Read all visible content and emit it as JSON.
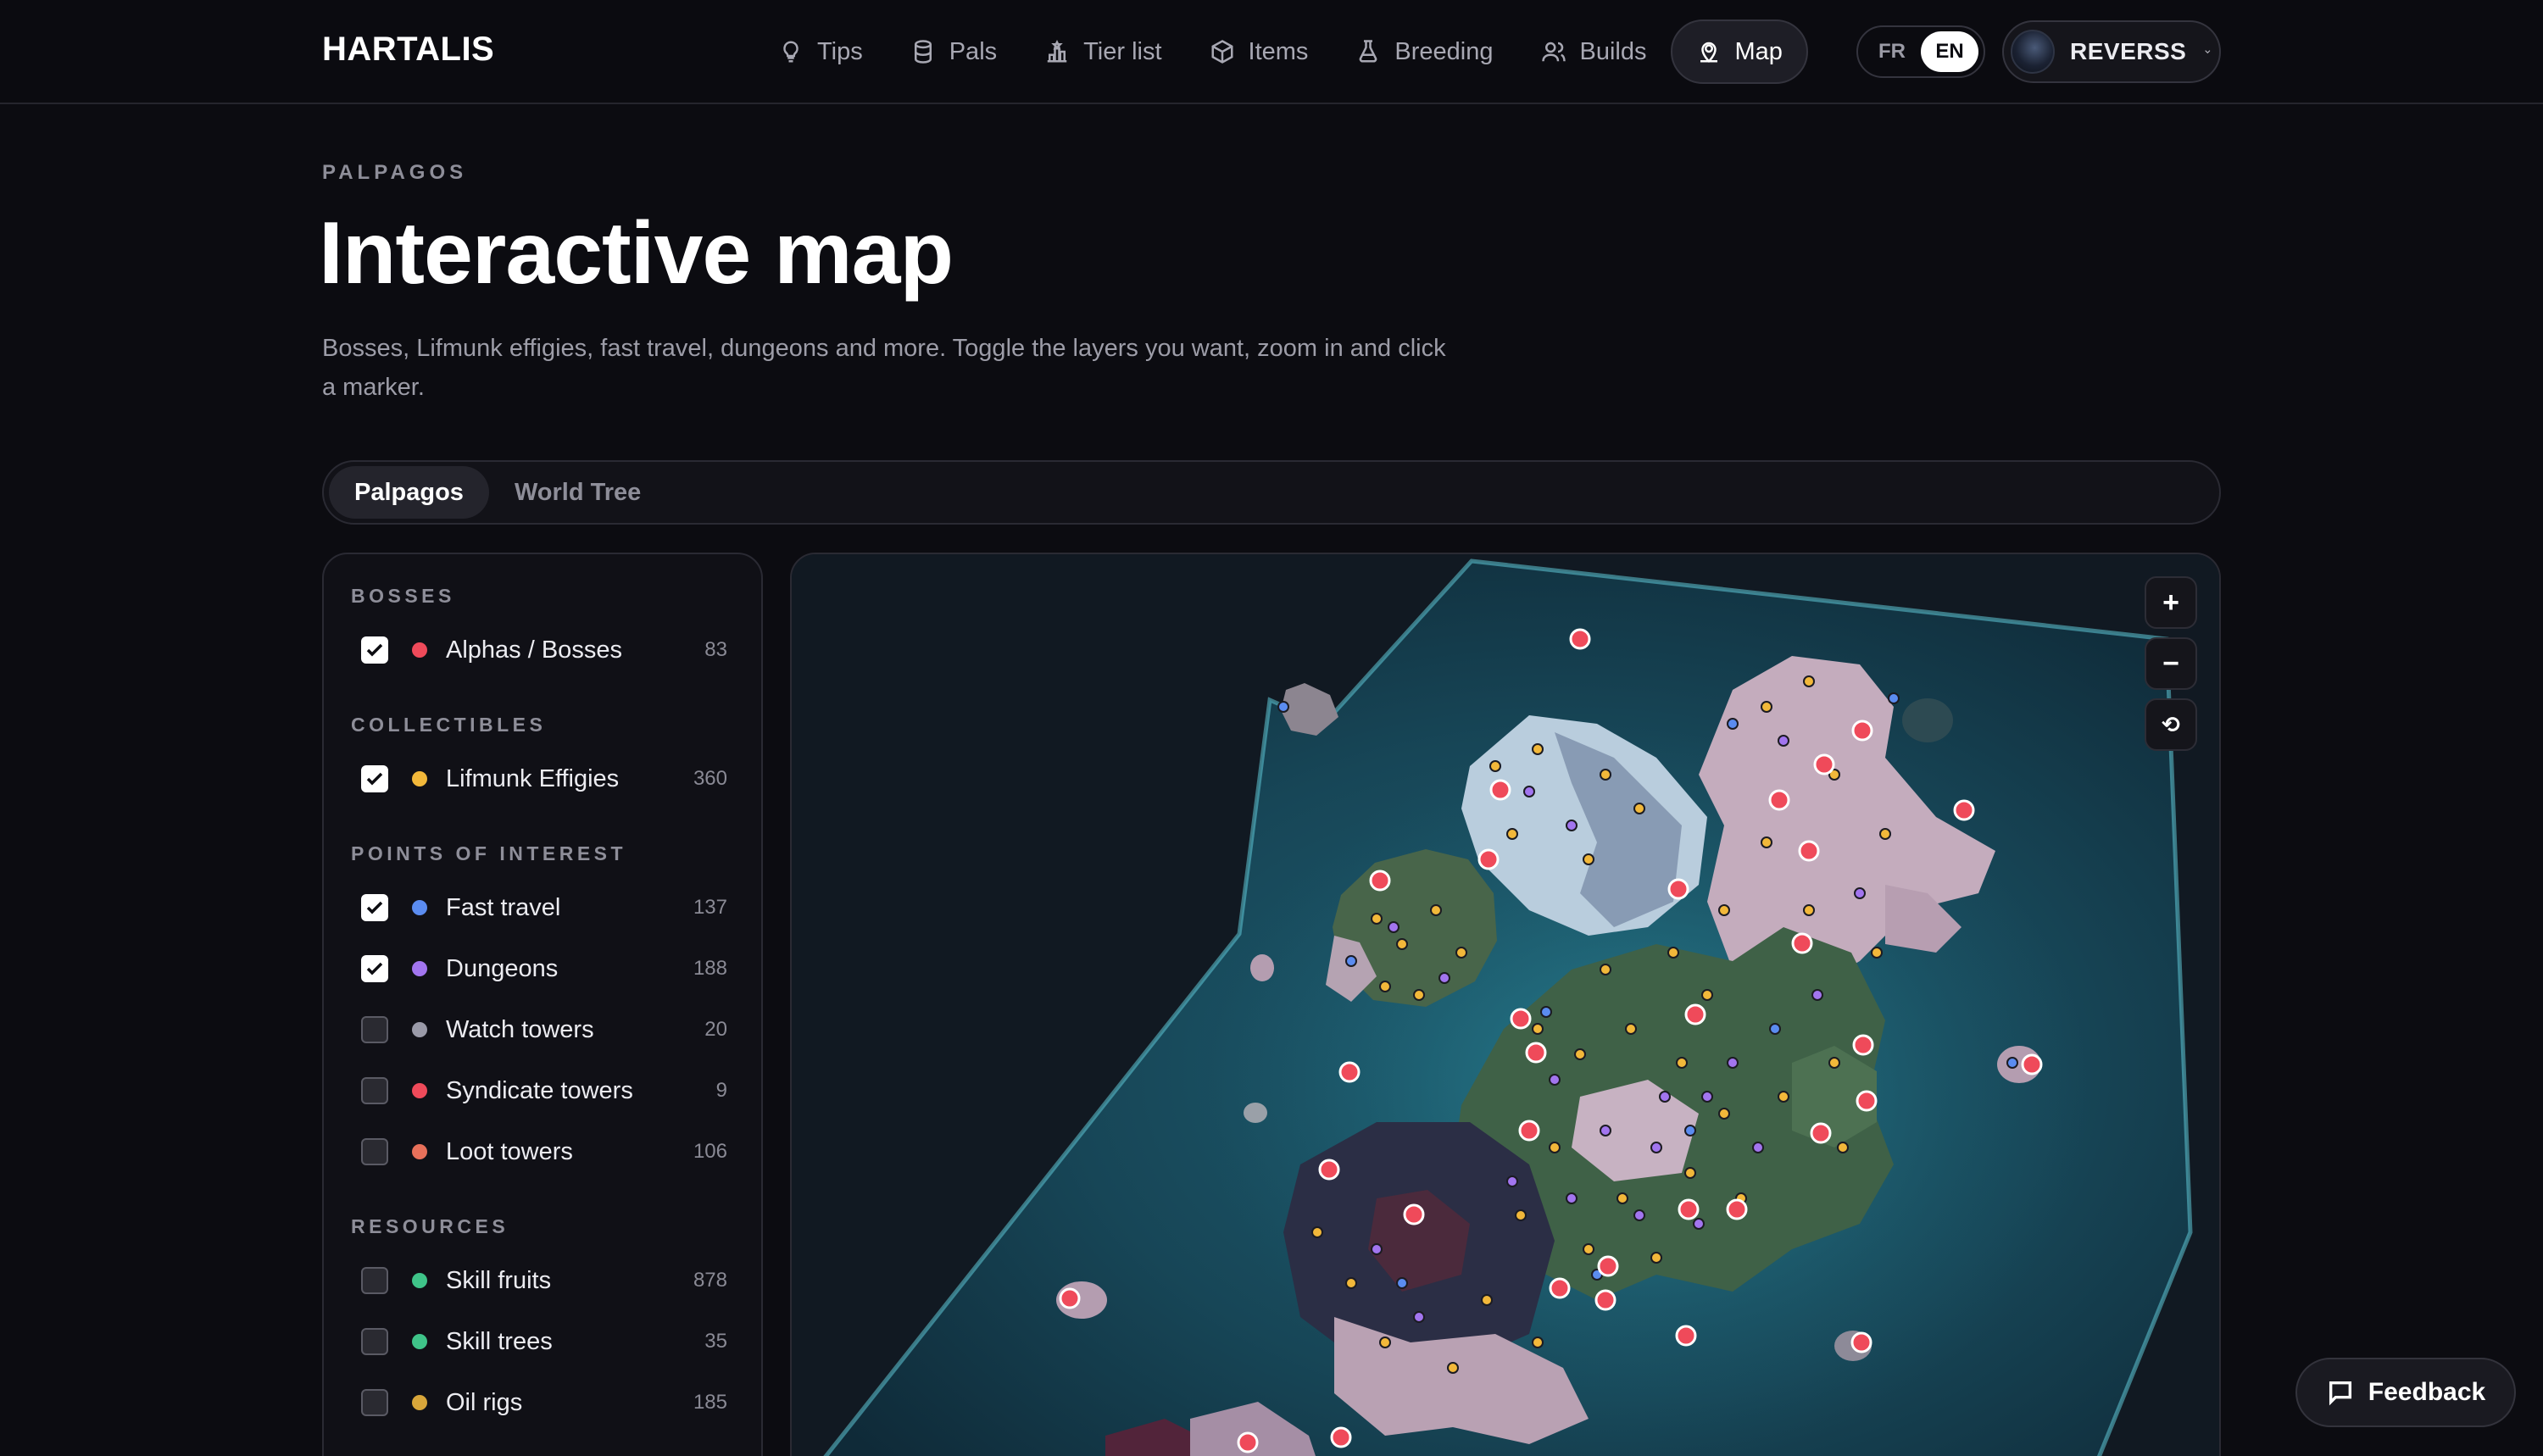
{
  "header": {
    "logo": "HARTALIS",
    "nav": [
      {
        "label": "Tips",
        "icon": "lightbulb-icon"
      },
      {
        "label": "Pals",
        "icon": "database-icon"
      },
      {
        "label": "Tier list",
        "icon": "podium-icon"
      },
      {
        "label": "Items",
        "icon": "cube-icon"
      },
      {
        "label": "Breeding",
        "icon": "flask-icon"
      },
      {
        "label": "Builds",
        "icon": "users-icon"
      },
      {
        "label": "Map",
        "icon": "map-pin-icon",
        "active": true
      }
    ],
    "lang": {
      "fr": "FR",
      "en": "EN",
      "selected": "EN"
    },
    "user": {
      "name": "REVERSS"
    }
  },
  "page": {
    "eyebrow": "PALPAGOS",
    "title": "Interactive map",
    "subtitle": "Bosses, Lifmunk effigies, fast travel, dungeons and more. Toggle the layers you want, zoom in and click a marker."
  },
  "tabs": [
    {
      "label": "Palpagos",
      "active": true
    },
    {
      "label": "World Tree",
      "active": false
    }
  ],
  "layers": {
    "groups": [
      {
        "title": "BOSSES",
        "items": [
          {
            "label": "Alphas / Bosses",
            "count": "83",
            "color": "#ef4a5a",
            "checked": true
          }
        ]
      },
      {
        "title": "COLLECTIBLES",
        "items": [
          {
            "label": "Lifmunk Effigies",
            "count": "360",
            "color": "#f2b83a",
            "checked": true
          }
        ]
      },
      {
        "title": "POINTS OF INTEREST",
        "items": [
          {
            "label": "Fast travel",
            "count": "137",
            "color": "#5b8cf0",
            "checked": true
          },
          {
            "label": "Dungeons",
            "count": "188",
            "color": "#a275ef",
            "checked": true
          },
          {
            "label": "Watch towers",
            "count": "20",
            "color": "#9a9aa8",
            "checked": false
          },
          {
            "label": "Syndicate towers",
            "count": "9",
            "color": "#ef4a5a",
            "checked": false
          },
          {
            "label": "Loot towers",
            "count": "106",
            "color": "#e8705a",
            "checked": false
          }
        ]
      },
      {
        "title": "RESOURCES",
        "items": [
          {
            "label": "Skill fruits",
            "count": "878",
            "color": "#3fc489",
            "checked": false
          },
          {
            "label": "Skill trees",
            "count": "35",
            "color": "#3fc489",
            "checked": false
          },
          {
            "label": "Oil rigs",
            "count": "185",
            "color": "#d8a63a",
            "checked": false
          }
        ]
      }
    ]
  },
  "map_controls": {
    "zoom_in": "+",
    "zoom_out": "−",
    "reset": "⟲"
  },
  "feedback": {
    "label": "Feedback"
  }
}
